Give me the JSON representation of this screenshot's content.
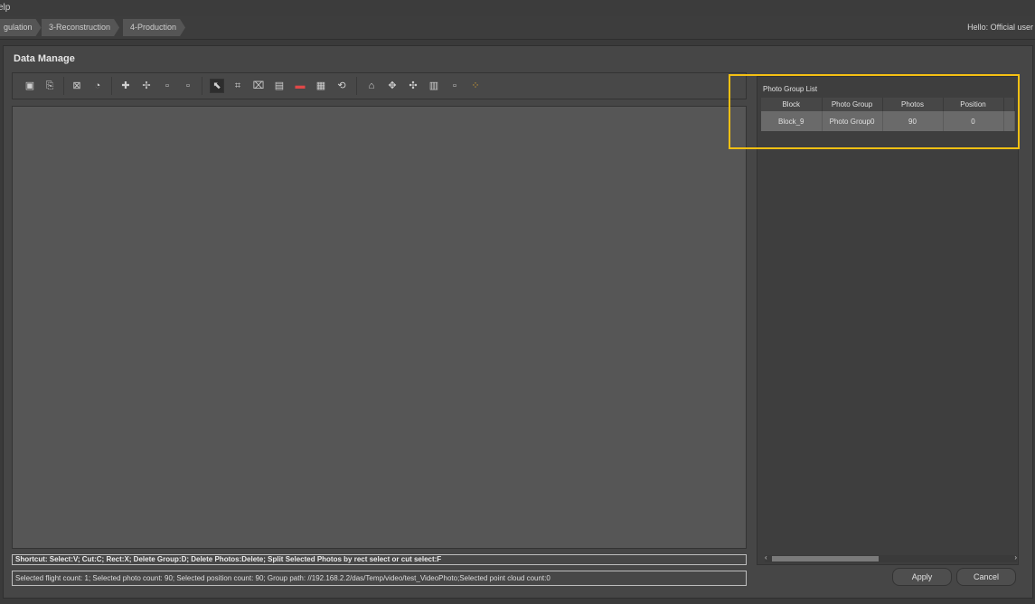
{
  "menubar": {
    "text": "elp"
  },
  "breadcrumbs": [
    "gulation",
    "3-Reconstruction",
    "4-Production"
  ],
  "header": {
    "greeting": "Hello: Official user"
  },
  "dialog": {
    "title": "Data Manage",
    "shortcut_text": "Shortcut: Select:V; Cut:C; Rect:X; Delete Group:D; Delete Photos:Delete; Split Selected Photos by rect select or cut select:F",
    "status_text": "Selected flight count: 1; Selected photo count: 90; Selected position count: 90; Group path: //192.168.2.2/das/Temp/video/test_VideoPhoto;Selected point cloud count:0",
    "apply_label": "Apply",
    "cancel_label": "Cancel"
  },
  "toolbar": {
    "icons": [
      "import-photos-icon",
      "import-video-icon",
      "import-control-points-icon",
      "import-pointcloud-icon",
      "add-group-icon",
      "add-position-icon",
      "kml-import-icon",
      "kml-export-icon",
      "select-icon",
      "rect-select-icon",
      "cut-icon",
      "export-icon",
      "delete-group-icon",
      "split-icon",
      "refresh-icon",
      "home-icon",
      "center-icon",
      "point-icon",
      "table-view-icon",
      "kml-icon",
      "settings-icon"
    ]
  },
  "photo_group_list": {
    "title": "Photo Group List",
    "columns": [
      "Block",
      "Photo Group",
      "Photos",
      "Position"
    ],
    "rows": [
      {
        "block": "Block_9",
        "photo_group": "Photo Group0",
        "photos": "90",
        "position": "0"
      }
    ]
  }
}
